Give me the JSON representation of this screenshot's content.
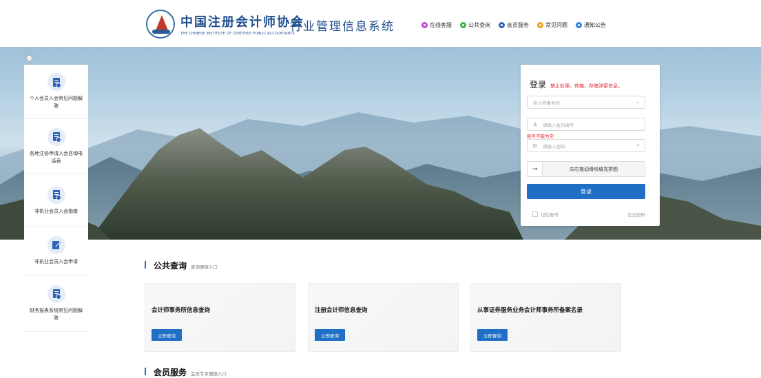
{
  "header": {
    "logo_cn": "中国注册会计师协会",
    "logo_en": "THE CHINESE INSTITUTE OF CERTIFIED PUBLIC ACCOUNTANTS",
    "system_title": "行业管理信息系统",
    "nav": [
      {
        "label": "在线客服",
        "color": "#c04bd6"
      },
      {
        "label": "公共查询",
        "color": "#3fb24a"
      },
      {
        "label": "会员服务",
        "color": "#2f62b7"
      },
      {
        "label": "常见问题",
        "color": "#f0a020"
      },
      {
        "label": "通知公告",
        "color": "#2f86e0"
      }
    ]
  },
  "collapse_icon": "minus",
  "sidebar": {
    "items": [
      {
        "label": "个人会员入会常见问题解答",
        "icon": "document-icon"
      },
      {
        "label": "各地注协申请入会咨询电话表",
        "icon": "document-icon"
      },
      {
        "label": "非执业会员入会指南",
        "icon": "document-icon"
      },
      {
        "label": "非执业会员入会申请",
        "icon": "edit-icon"
      },
      {
        "label": "财务报表系统常见问题解答",
        "icon": "document-icon"
      }
    ]
  },
  "login": {
    "title": "登录",
    "warning": "禁止处理、传输、存储涉密信息。",
    "org_select": "会计师事务所",
    "member_placeholder": "请输入会员编号",
    "error": "账号不能为空",
    "password_placeholder": "请输入密码",
    "slider_text": "向右拖动滑块填充拼图",
    "slider_arrow": "→",
    "submit": "登录",
    "remember": "记住账号",
    "forgot": "忘记密码",
    "brand_color": "#1f6fc5"
  },
  "public_query": {
    "title": "公共查询",
    "subtitle": "查询便捷入口",
    "cards": [
      {
        "title": "会计师事务所信息查询",
        "button": "立即查询"
      },
      {
        "title": "注册会计师信息查询",
        "button": "立即查询"
      },
      {
        "title": "从事证券服务业务会计师事务所备案名录",
        "button": "立即查询"
      }
    ]
  },
  "member_service": {
    "title": "会员服务",
    "subtitle": "会员专享便捷入口"
  }
}
